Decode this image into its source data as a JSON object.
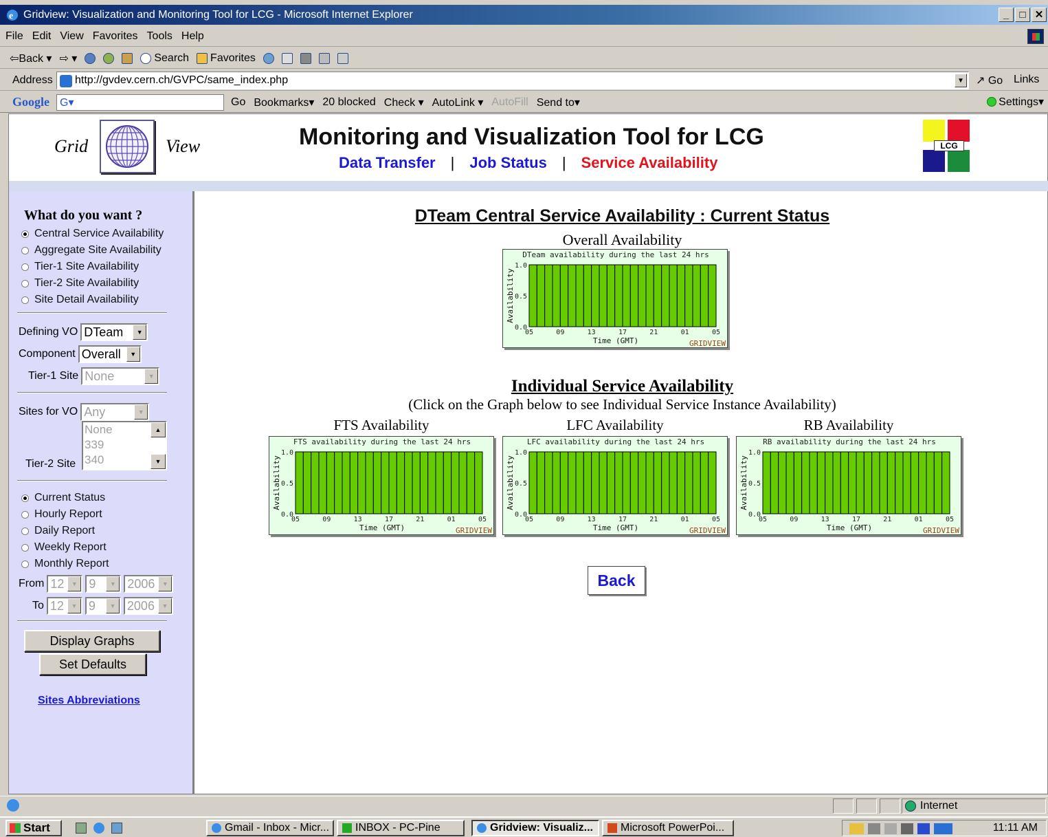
{
  "window": {
    "title": "Gridview: Visualization and Monitoring Tool for LCG - Microsoft Internet Explorer",
    "min": "_",
    "max": "□",
    "close": "✕"
  },
  "menu": [
    "File",
    "Edit",
    "View",
    "Favorites",
    "Tools",
    "Help"
  ],
  "toolbar": {
    "back": "⇦Back ▾",
    "forward": "⇨ ▾",
    "search": "Search",
    "favorites": "Favorites"
  },
  "address": {
    "label": "Address",
    "url": "http://gvdev.cern.ch/GVPC/same_index.php",
    "go": "Go",
    "links": "Links"
  },
  "googlebar": {
    "logo": "Google",
    "search_value": "G▾",
    "go": "Go",
    "bookmarks": "Bookmarks▾",
    "blocked": "20 blocked",
    "check": "Check ▾",
    "autolink": "AutoLink ▾",
    "autofill": "AutoFill",
    "sendto": "Send to▾",
    "settings": "Settings▾"
  },
  "header": {
    "grid_word": "Grid",
    "view_word": "View",
    "title": "Monitoring and Visualization Tool for LCG",
    "nav": {
      "data_transfer": "Data Transfer",
      "job_status": "Job Status",
      "service_availability": "Service Availability",
      "sep": "|"
    },
    "lcg_label": "LCG",
    "lcg_colors": [
      "#f5f51e",
      "#e3102a",
      "#1a1a8c",
      "#1a8c3a"
    ]
  },
  "sidebar": {
    "question": "What do you want ?",
    "options": [
      {
        "label": "Central Service Availability",
        "selected": true
      },
      {
        "label": "Aggregate Site Availability",
        "selected": false
      },
      {
        "label": "Tier-1 Site Availability",
        "selected": false
      },
      {
        "label": "Tier-2 Site Availability",
        "selected": false
      },
      {
        "label": "Site Detail Availability",
        "selected": false
      }
    ],
    "defining_vo_label": "Defining VO",
    "defining_vo_value": "DTeam",
    "component_label": "Component",
    "component_value": "Overall",
    "tier1_label": "Tier-1 Site",
    "tier1_value": "None",
    "sites_for_vo_label": "Sites for VO",
    "sites_for_vo_value": "Any",
    "tier2_label": "Tier-2 Site",
    "tier2_items": [
      "None",
      "339",
      "340"
    ],
    "reports": [
      {
        "label": "Current Status",
        "selected": true
      },
      {
        "label": "Hourly Report",
        "selected": false
      },
      {
        "label": "Daily Report",
        "selected": false
      },
      {
        "label": "Weekly Report",
        "selected": false
      },
      {
        "label": "Monthly Report",
        "selected": false
      }
    ],
    "from_label": "From",
    "to_label": "To",
    "from": {
      "month": "12",
      "day": "9",
      "year": "2006"
    },
    "to": {
      "month": "12",
      "day": "9",
      "year": "2006"
    },
    "display_graphs": "Display Graphs",
    "set_defaults": "Set Defaults",
    "sites_abbreviations": "Sites Abbreviations"
  },
  "main": {
    "heading": "DTeam Central Service Availability : Current Status",
    "overall_label": "Overall Availability",
    "individual_heading": "Individual Service Availability",
    "individual_hint": "(Click on the Graph below to see Individual Service Instance Availability)",
    "fts_label": "FTS Availability",
    "lfc_label": "LFC Availability",
    "rb_label": "RB Availability",
    "back": "Back"
  },
  "chart_data": [
    {
      "type": "bar",
      "id": "overall",
      "title": "DTeam availability during the last 24 hrs",
      "xlabel": "Time (GMT)",
      "ylabel": "Availability",
      "ylim": [
        0,
        1.0
      ],
      "yticks": [
        "0.0",
        "0.5",
        "1.0"
      ],
      "xticks": [
        "05",
        "09",
        "13",
        "17",
        "21",
        "01",
        "05"
      ],
      "values": [
        1,
        1,
        1,
        1,
        1,
        1,
        1,
        1,
        1,
        1,
        1,
        1,
        1,
        1,
        1,
        1,
        1,
        1,
        1,
        1,
        1,
        1,
        1,
        1
      ],
      "watermark": "GRIDVIEW",
      "bar_color": "#66cc00"
    },
    {
      "type": "bar",
      "id": "fts",
      "title": "FTS availability during the last 24 hrs",
      "xlabel": "Time (GMT)",
      "ylabel": "Availability",
      "ylim": [
        0,
        1.0
      ],
      "yticks": [
        "0.0",
        "0.5",
        "1.0"
      ],
      "xticks": [
        "05",
        "09",
        "13",
        "17",
        "21",
        "01",
        "05"
      ],
      "values": [
        1,
        1,
        1,
        1,
        1,
        1,
        1,
        1,
        1,
        1,
        1,
        1,
        1,
        1,
        1,
        1,
        1,
        1,
        1,
        1,
        1,
        1,
        1,
        1
      ],
      "watermark": "GRIDVIEW",
      "bar_color": "#66cc00"
    },
    {
      "type": "bar",
      "id": "lfc",
      "title": "LFC availability during the last 24 hrs",
      "xlabel": "Time (GMT)",
      "ylabel": "Availability",
      "ylim": [
        0,
        1.0
      ],
      "yticks": [
        "0.0",
        "0.5",
        "1.0"
      ],
      "xticks": [
        "05",
        "09",
        "13",
        "17",
        "21",
        "01",
        "05"
      ],
      "values": [
        1,
        1,
        1,
        1,
        1,
        1,
        1,
        1,
        1,
        1,
        1,
        1,
        1,
        1,
        1,
        1,
        1,
        1,
        1,
        1,
        1,
        1,
        1,
        1
      ],
      "watermark": "GRIDVIEW",
      "bar_color": "#66cc00"
    },
    {
      "type": "bar",
      "id": "rb",
      "title": "RB availability during the last 24 hrs",
      "xlabel": "Time (GMT)",
      "ylabel": "Availability",
      "ylim": [
        0,
        1.0
      ],
      "yticks": [
        "0.0",
        "0.5",
        "1.0"
      ],
      "xticks": [
        "05",
        "09",
        "13",
        "17",
        "21",
        "01",
        "05"
      ],
      "values": [
        1,
        1,
        1,
        1,
        1,
        1,
        1,
        1,
        1,
        1,
        1,
        1,
        1,
        1,
        1,
        1,
        1,
        1,
        1,
        1,
        1,
        1,
        1,
        1
      ],
      "watermark": "GRIDVIEW",
      "bar_color": "#66cc00"
    }
  ],
  "statusbar": {
    "zone": "Internet"
  },
  "taskbar": {
    "start": "Start",
    "tasks": [
      "Gmail - Inbox - Micr...",
      "INBOX - PC-Pine",
      "Gridview: Visualiz...",
      "Microsoft PowerPoi..."
    ],
    "clock": "11:11 AM"
  }
}
